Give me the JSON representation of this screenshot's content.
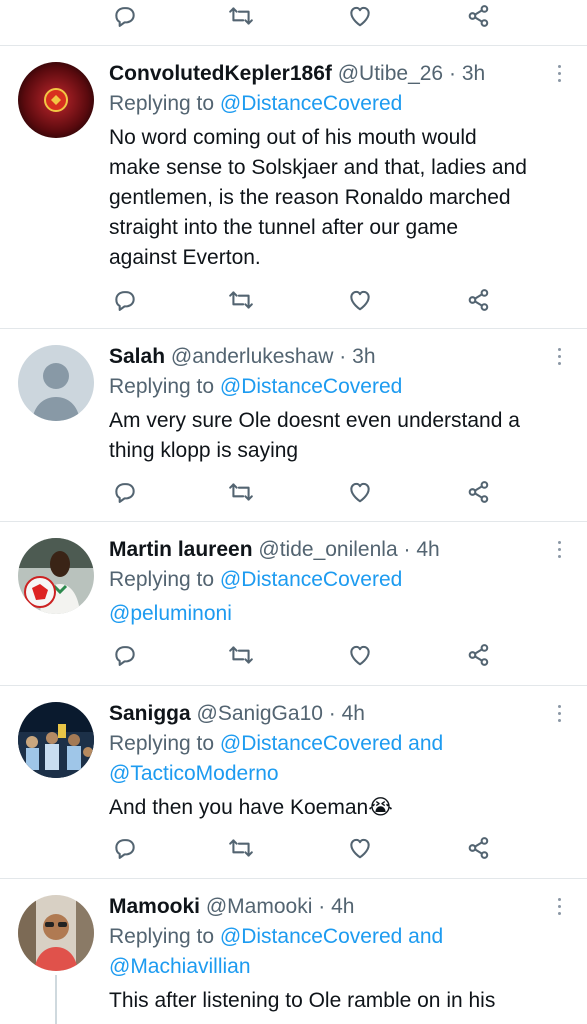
{
  "tweets": [
    {
      "name": "ConvolutedKepler186f",
      "handle": "@Utibe_26",
      "dot": "·",
      "time": "3h",
      "reply_prefix": "Replying to",
      "reply_to": "@DistanceCovered",
      "reply_and": "",
      "reply_to2": "",
      "text": [
        "No word coming out of his mouth would",
        "make sense to Solskjaer and that, ladies and",
        "gentlemen, is the reason Ronaldo marched",
        "straight into the tunnel after our game",
        "against Everton."
      ]
    },
    {
      "name": "Salah",
      "handle": "@anderlukeshaw",
      "dot": "·",
      "time": "3h",
      "reply_prefix": "Replying to",
      "reply_to": "@DistanceCovered",
      "reply_and": "",
      "reply_to2": "",
      "text": [
        "Am very sure Ole doesnt even understand a",
        "thing klopp is saying"
      ]
    },
    {
      "name": "Martin laureen",
      "handle": "@tide_onilenla",
      "dot": "·",
      "time": "4h",
      "reply_prefix": "Replying to",
      "reply_to": "@DistanceCovered",
      "reply_and": "",
      "reply_to2": "",
      "mention": "@peluminoni"
    },
    {
      "name": "Sanigga",
      "handle": "@SanigGa10",
      "dot": "·",
      "time": "4h",
      "reply_prefix": "Replying to",
      "reply_to": "@DistanceCovered",
      "reply_and": "and",
      "reply_to2": "@TacticoModerno",
      "text": [
        "And then you have Koeman😭"
      ]
    },
    {
      "name": "Mamooki",
      "handle": "@Mamooki",
      "dot": "·",
      "time": "4h",
      "reply_prefix": "Replying to",
      "reply_to": "@DistanceCovered",
      "reply_and": "and",
      "reply_to2": "@Machiavillian",
      "text": [
        "This after listening to Ole ramble on in his"
      ]
    }
  ],
  "colors": {
    "link": "#1d9bf0",
    "secondary": "#536471",
    "divider": "#e3e7ea"
  },
  "icons": [
    "reply-icon",
    "retweet-icon",
    "like-icon",
    "share-icon",
    "more-icon"
  ]
}
